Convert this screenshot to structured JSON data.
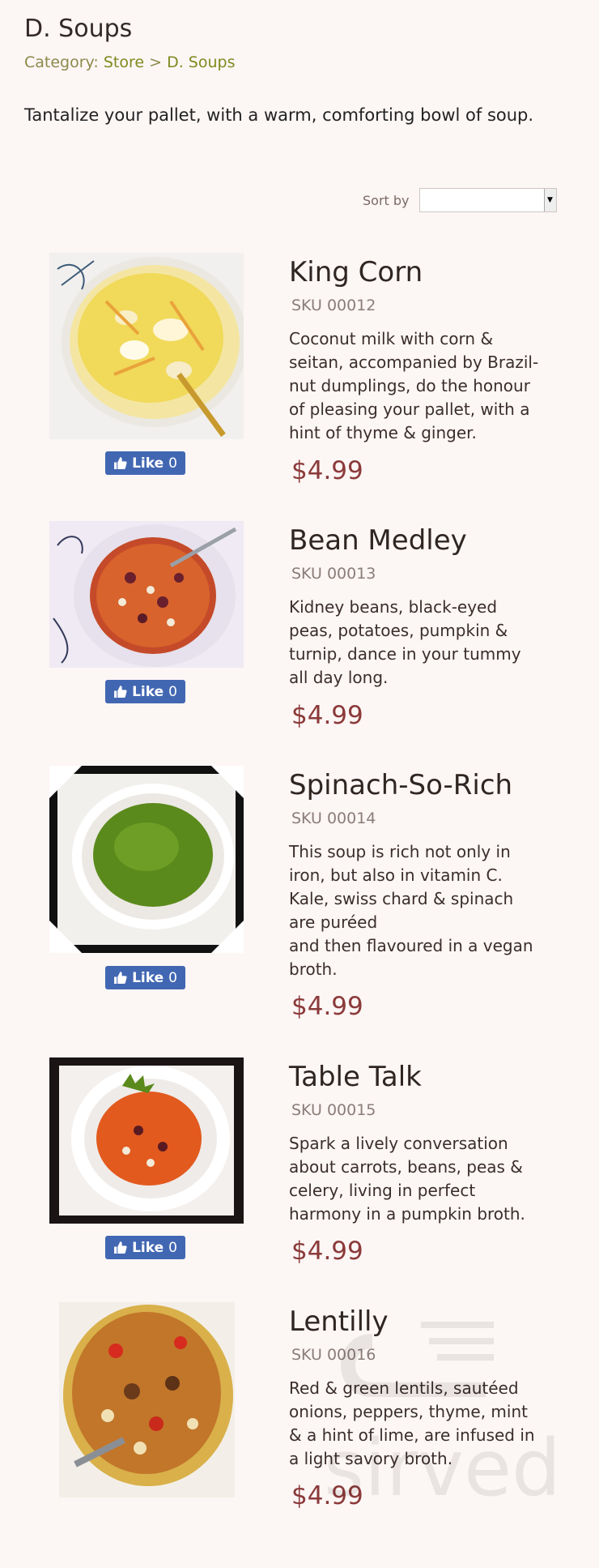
{
  "page": {
    "title": "D. Soups",
    "breadcrumb": {
      "prefix": "Category:",
      "store": "Store",
      "separator": ">",
      "current": "D. Soups"
    },
    "intro": "Tantalize your pallet, with a warm, comforting bowl of soup."
  },
  "sort": {
    "label": "Sort by",
    "value": ""
  },
  "like": {
    "label": "Like",
    "count": "0"
  },
  "products": [
    {
      "name": "King Corn",
      "sku": "SKU 00012",
      "description": "Coconut milk with corn &\nseitan, accompanied by Brazil-\nnut dumplings, do the honour\nof pleasing your pallet, with a\nhint of thyme & ginger.",
      "price": "$4.99"
    },
    {
      "name": "Bean Medley",
      "sku": "SKU 00013",
      "description": "Kidney beans, black-eyed\npeas, potatoes, pumpkin &\nturnip, dance in your tummy\nall day long.",
      "price": "$4.99"
    },
    {
      "name": "Spinach-So-Rich",
      "sku": "SKU 00014",
      "description": "This soup is rich not only in\niron, but also in vitamin C.\n Kale, swiss chard & spinach\nare puréed\nand then flavoured in a vegan\nbroth.",
      "price": "$4.99"
    },
    {
      "name": "Table Talk",
      "sku": "SKU 00015",
      "description": "Spark a lively conversation\nabout carrots, beans, peas &\ncelery, living in perfect\nharmony in a pumpkin broth.",
      "price": "$4.99"
    },
    {
      "name": "Lentilly",
      "sku": "SKU 00016",
      "description": "Red & green lentils, sautéed\nonions, peppers, thyme, mint\n& a hint of lime, are infused in\na light savory broth.",
      "price": "$4.99"
    }
  ],
  "watermark": {
    "text": "sirved"
  }
}
